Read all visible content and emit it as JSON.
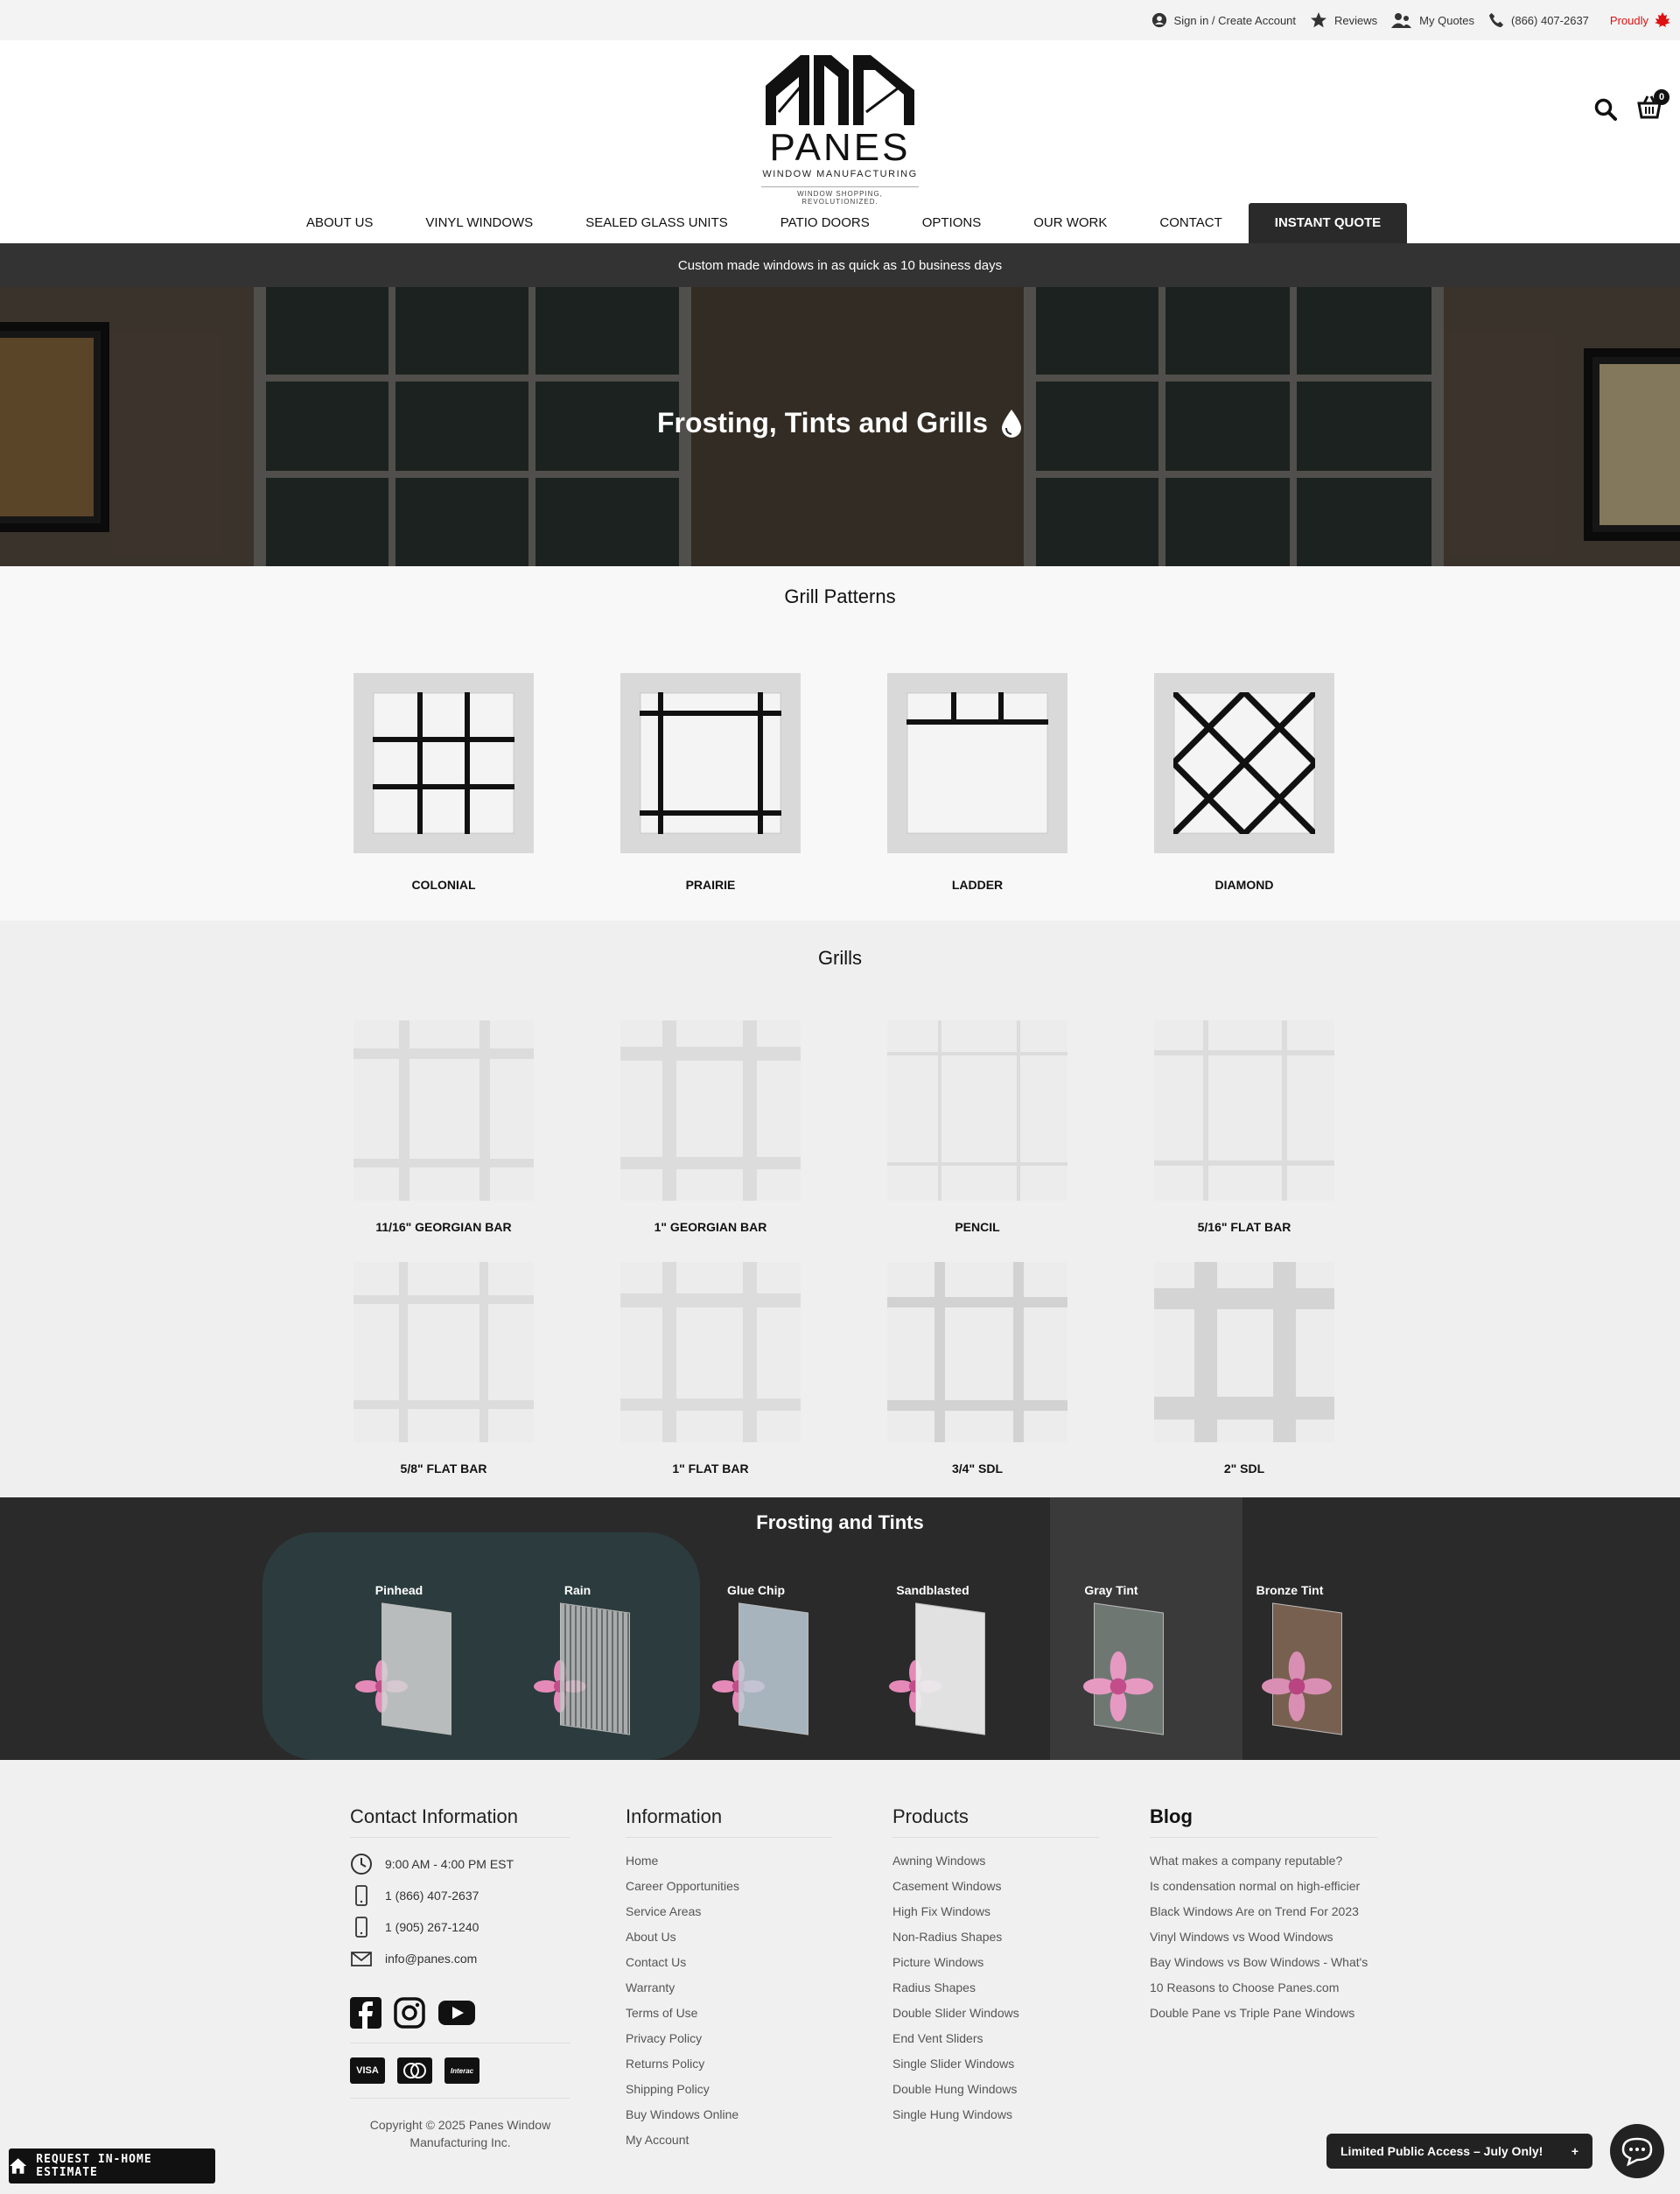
{
  "topbar": {
    "signin": "Sign in / Create Account",
    "reviews": "Reviews",
    "quotes": "My Quotes",
    "phone": "(866) 407-2637",
    "proudly": "Proudly"
  },
  "logo": {
    "brand": "PANES",
    "sub": "WINDOW MANUFACTURING",
    "tagline": "WINDOW SHOPPING, REVOLUTIONIZED."
  },
  "cart_count": "0",
  "nav": [
    "ABOUT US",
    "VINYL WINDOWS",
    "SEALED GLASS UNITS",
    "PATIO DOORS",
    "OPTIONS",
    "OUR WORK",
    "CONTACT",
    "INSTANT QUOTE"
  ],
  "promo": "Custom made windows in as quick as 10 business days",
  "hero_title": "Frosting, Tints and Grills",
  "patterns": {
    "title": "Grill Patterns",
    "items": [
      "COLONIAL",
      "PRAIRIE",
      "LADDER",
      "DIAMOND"
    ]
  },
  "grills": {
    "title": "Grills",
    "items": [
      "11/16\" GEORGIAN BAR",
      "1\" GEORGIAN BAR",
      "PENCIL",
      "5/16\" FLAT BAR",
      "5/8\" FLAT BAR",
      "1\" FLAT BAR",
      "3/4\" SDL",
      "2\" SDL"
    ]
  },
  "frosting": {
    "title": "Frosting and Tints",
    "items": [
      "Pinhead",
      "Rain",
      "Glue Chip",
      "Sandblasted",
      "Gray Tint",
      "Bronze Tint"
    ]
  },
  "footer": {
    "contact": {
      "title": "Contact Information",
      "hours": "9:00 AM - 4:00 PM EST",
      "phone1": "1 (866) 407-2637",
      "phone2": "1 (905) 267-1240",
      "email": "info@panes.com"
    },
    "information": {
      "title": "Information",
      "links": [
        "Home",
        "Career Opportunities",
        "Service Areas",
        "About Us",
        "Contact Us",
        "Warranty",
        "Terms of Use",
        "Privacy Policy",
        "Returns Policy",
        "Shipping Policy",
        "Buy Windows Online",
        "My Account"
      ]
    },
    "products": {
      "title": "Products",
      "links": [
        "Awning Windows",
        "Casement Windows",
        "High Fix Windows",
        "Non-Radius Shapes",
        "Picture Windows",
        "Radius Shapes",
        "Double Slider Windows",
        "End Vent Sliders",
        "Single Slider Windows",
        "Double Hung Windows",
        "Single Hung Windows"
      ]
    },
    "blog": {
      "title": "Blog",
      "links": [
        "What makes a company reputable?",
        "Is condensation normal on high-efficier",
        "Black Windows Are on Trend For 2023",
        "Vinyl Windows vs Wood Windows",
        "Bay Windows vs Bow Windows - What's",
        "10 Reasons to Choose Panes.com",
        "Double Pane vs Triple Pane Windows"
      ]
    },
    "payments": [
      "VISA",
      "MC",
      "Interac"
    ],
    "copyright": "Copyright © 2025 Panes Window Manufacturing Inc."
  },
  "estimate_button": "REQUEST IN-HOME ESTIMATE",
  "limited_banner": "Limited Public Access – July Only!",
  "limited_plus": "+"
}
